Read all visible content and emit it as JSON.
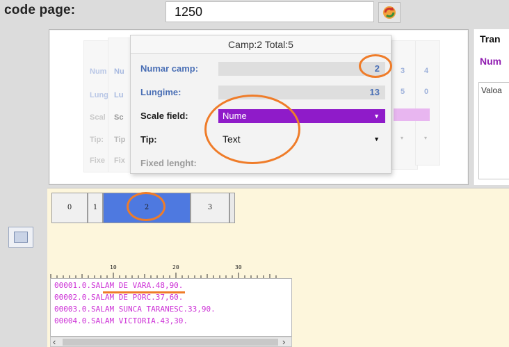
{
  "top_bar": {
    "code_page_label": "code page:",
    "code_page_value": "1250"
  },
  "popup": {
    "header": "Camp:2 Total:5",
    "numar_camp_label": "Numar camp:",
    "numar_camp_value": "2",
    "lungime_label": "Lungime:",
    "lungime_value": "13",
    "scale_field_label": "Scale field:",
    "scale_field_value": "Nume",
    "tip_label": "Tip:",
    "tip_value": "Text",
    "fixed_label": "Fixed lenght:"
  },
  "ghost": {
    "num_short": "Num",
    "nu_short": "Nu",
    "lung_short": "Lung",
    "lu_short": "Lu",
    "scal_short": "Scal",
    "sc_short": "Sc",
    "tip_short": "Tip:",
    "ti_short": "Tip",
    "fixe_short": "Fixe",
    "fi_short": "Fix",
    "cols_row1": [
      "3",
      "4"
    ],
    "cols_row2": [
      "5",
      "0"
    ]
  },
  "side": {
    "title": "Tran",
    "num": "Num",
    "box_text": "Valoa"
  },
  "tabs": [
    "0",
    "1",
    "2",
    "3"
  ],
  "ruler": {
    "marks": [
      "10",
      "20",
      "30"
    ]
  },
  "records": [
    "00001.0.SALAM DE VARA.48,90.",
    "00002.0.SALAM DE PORC.37,60.",
    "00003.0.SALAM SUNCA TARANESC.33,90.",
    "00004.0.SALAM VICTORIA.43,30."
  ],
  "colors": {
    "accent_purple": "#8f1bc9",
    "active_tab": "#4e79e0",
    "annotation": "#ef7c29",
    "record_text": "#cc2fd6"
  }
}
